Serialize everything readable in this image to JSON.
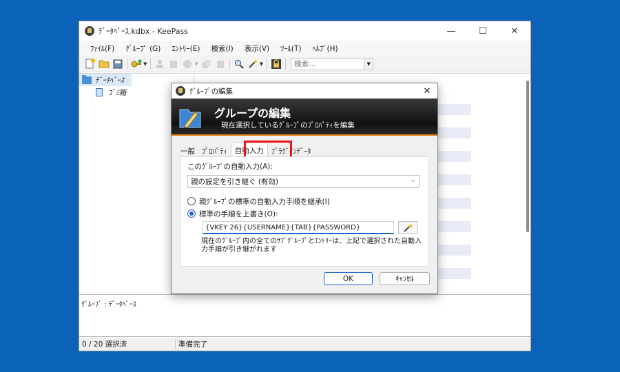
{
  "window": {
    "title": "ﾃﾞｰﾀﾍﾞｰｽ.kdbx - KeePass",
    "controls": [
      "—",
      "☐",
      "✕"
    ]
  },
  "menu": [
    "ﾌｧｲﾙ(F)",
    "ｸﾞﾙｰﾌﾟ (G)",
    "ｴﾝﾄﾘｰ(E)",
    "検索(I)",
    "表示(V)",
    "ﾂｰﾙ(T)",
    "ﾍﾙﾌﾟ(H)"
  ],
  "toolbar": {
    "search_placeholder": "検索..."
  },
  "tree": {
    "root": "ﾃﾞｰﾀﾍﾞｰｽ",
    "child": "ｺﾞﾐ箱"
  },
  "details": {
    "text": "ｸﾞﾙｰﾌﾟ : ﾃﾞｰﾀﾍﾞｰｽ"
  },
  "status": {
    "selection": "0 / 20 選択済",
    "state": "準備完了"
  },
  "dialog": {
    "title": "ｸﾞﾙｰﾌﾟの編集",
    "close": "✕",
    "banner_title": "グループの編集",
    "banner_subtitle": "現在選択しているｸﾞﾙｰﾌﾟのﾌﾟﾛﾊﾟﾃｨを編集",
    "tabs": [
      "一般",
      "ﾌﾟﾛﾊﾟﾃｨ",
      "自動入力",
      "ﾌﾟﾗｸﾞｲﾝﾃﾞｰﾀ"
    ],
    "active_tab": "自動入力",
    "autotype_label": "このｸﾞﾙｰﾌﾟの自動入力(A):",
    "autotype_value": "親の設定を引き継ぐ (有効)",
    "radio_inherit": "親ｸﾞﾙｰﾌﾟの標準の自動入力手順を継承(I)",
    "radio_override": "標準の手順を上書き(O):",
    "sequence_value": "{VKEY 26}{USERNAME}{TAB}{PASSWORD}",
    "note": "現在のｸﾞﾙｰﾌﾟ内の全てのｻﾌﾞｸﾞﾙｰﾌﾟとｴﾝﾄﾘｰは、上記で選択された自動入力手順が引き継がれます",
    "ok_label": "OK",
    "cancel_label": "ｷｬﾝｾﾙ"
  },
  "colors": {
    "desktop": "#0a63b8",
    "highlight_box": "#e8161b",
    "banner_accent": "#e07b14",
    "focus_blue": "#1c64c8"
  }
}
